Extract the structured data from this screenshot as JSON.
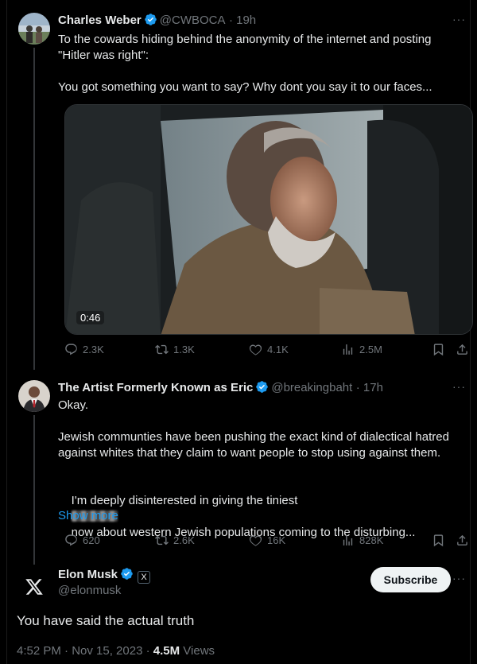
{
  "tweet1": {
    "author": "Charles Weber",
    "handle": "@CWBOCA",
    "time": "· 19h",
    "text": "To the cowards hiding behind the anonymity of the internet and posting \"Hitler was right\":\n\nYou got something you want to say? Why dont you say it to our faces...",
    "video_duration": "0:46",
    "replies": "2.3K",
    "reposts": "1.3K",
    "likes": "4.1K",
    "views": "2.5M"
  },
  "tweet2": {
    "author": "The Artist Formerly Known as Eric",
    "handle": "@breakingbaht",
    "time": "· 17h",
    "line1": "Okay.",
    "line2": "Jewish communties have been pushing the exact kind of dialectical hatred against whites that they claim to want people to stop using against them.",
    "line3_a": "I'm deeply disinterested in giving the tiniest",
    "line3_b": "now about western Jewish populations coming to the disturbing...",
    "show_more": "Show more",
    "replies": "620",
    "reposts": "2.6K",
    "likes": "16K",
    "views": "828K"
  },
  "tweet3": {
    "author": "Elon Musk",
    "handle": "@elonmusk",
    "subscribe_label": "Subscribe",
    "text": "You have said the actual truth",
    "timestamp": "4:52 PM · Nov 15, 2023 ·",
    "views_count": "4.5M",
    "views_label": "Views",
    "affiliate_badge": "X"
  },
  "colors": {
    "background": "#000000",
    "text": "#e7e9ea",
    "muted": "#71767b",
    "link": "#1d9bf0",
    "verified": "#1d9bf0"
  },
  "icons": [
    "more-icon",
    "verified-icon",
    "reply-icon",
    "repost-icon",
    "like-icon",
    "views-icon",
    "bookmark-icon",
    "share-icon",
    "x-logo-icon"
  ]
}
